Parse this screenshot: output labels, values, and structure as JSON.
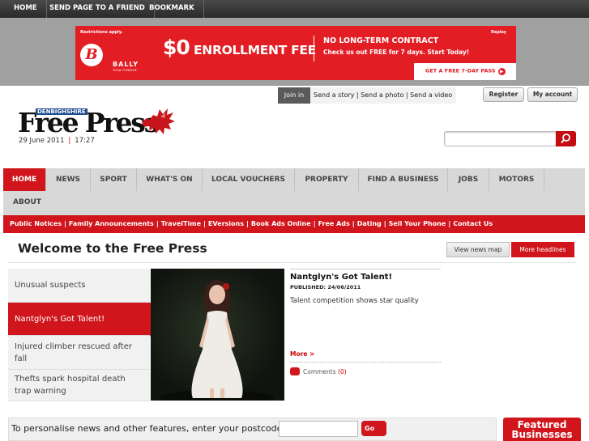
{
  "topbar": {
    "items": [
      "HOME",
      "SEND PAGE TO A FRIEND",
      "BOOKMARK"
    ]
  },
  "ad": {
    "restrictions": "Restrictions apply.",
    "replay": "Replay",
    "brand_letter": "B",
    "brand": "BALLY",
    "brand_sub": "TOTAL FITNESS®",
    "amount": "$0",
    "headline": "ENROLLMENT FEE",
    "tagline1": "NO LONG-TERM CONTRACT",
    "tagline2": "Check us out FREE for 7 days. Start Today!",
    "cta": "GET A FREE 7-DAY PASS",
    "cta_icon": "play-icon",
    "accent": "#e21d24"
  },
  "userbar": {
    "join_label": "Join in",
    "send_story": "Send a story",
    "send_photo": "Send a photo",
    "send_video": "Send a video",
    "divider": "|",
    "register": "Register",
    "account": "My account"
  },
  "masthead": {
    "region": "DENBIGHSHIRE",
    "title": "Free Press",
    "date": "29 June 2011",
    "sep": "|",
    "time": "17:27",
    "logo_icon": "welsh-dragon-icon",
    "search_icon": "search-icon"
  },
  "nav": {
    "items": [
      "HOME",
      "NEWS",
      "SPORT",
      "WHAT'S ON",
      "LOCAL VOUCHERS",
      "PROPERTY",
      "FIND A BUSINESS",
      "JOBS",
      "MOTORS"
    ],
    "about": "ABOUT",
    "active_color": "#d0161c"
  },
  "subnav": {
    "items": [
      "Public Notices",
      "Family Announcements",
      "TravelTime",
      "EVersions",
      "Book Ads Online",
      "Free Ads",
      "Dating",
      "Sell Your Phone",
      "Contact Us"
    ],
    "sep": "|"
  },
  "main": {
    "heading": "Welcome to the Free Press",
    "view_map": "View news map",
    "more_headlines": "More headlines",
    "stories": [
      "Unusual suspects",
      "Nantglyn's Got Talent!",
      "Injured climber rescued after fall",
      "Thefts spark hospital death trap warning"
    ],
    "featured_story": {
      "title": "Nantglyn's Got Talent!",
      "published": "PUBLISHED: 24/06/2011",
      "summary": "Talent competition shows star quality",
      "more": "More >",
      "comments_label": "Comments",
      "comments_count": "(0)",
      "comment_icon": "speech-bubble-icon"
    }
  },
  "postcode": {
    "label": "To personalise news and other features, enter your postcode:",
    "go": "Go",
    "featured": "Featured Businesses"
  }
}
